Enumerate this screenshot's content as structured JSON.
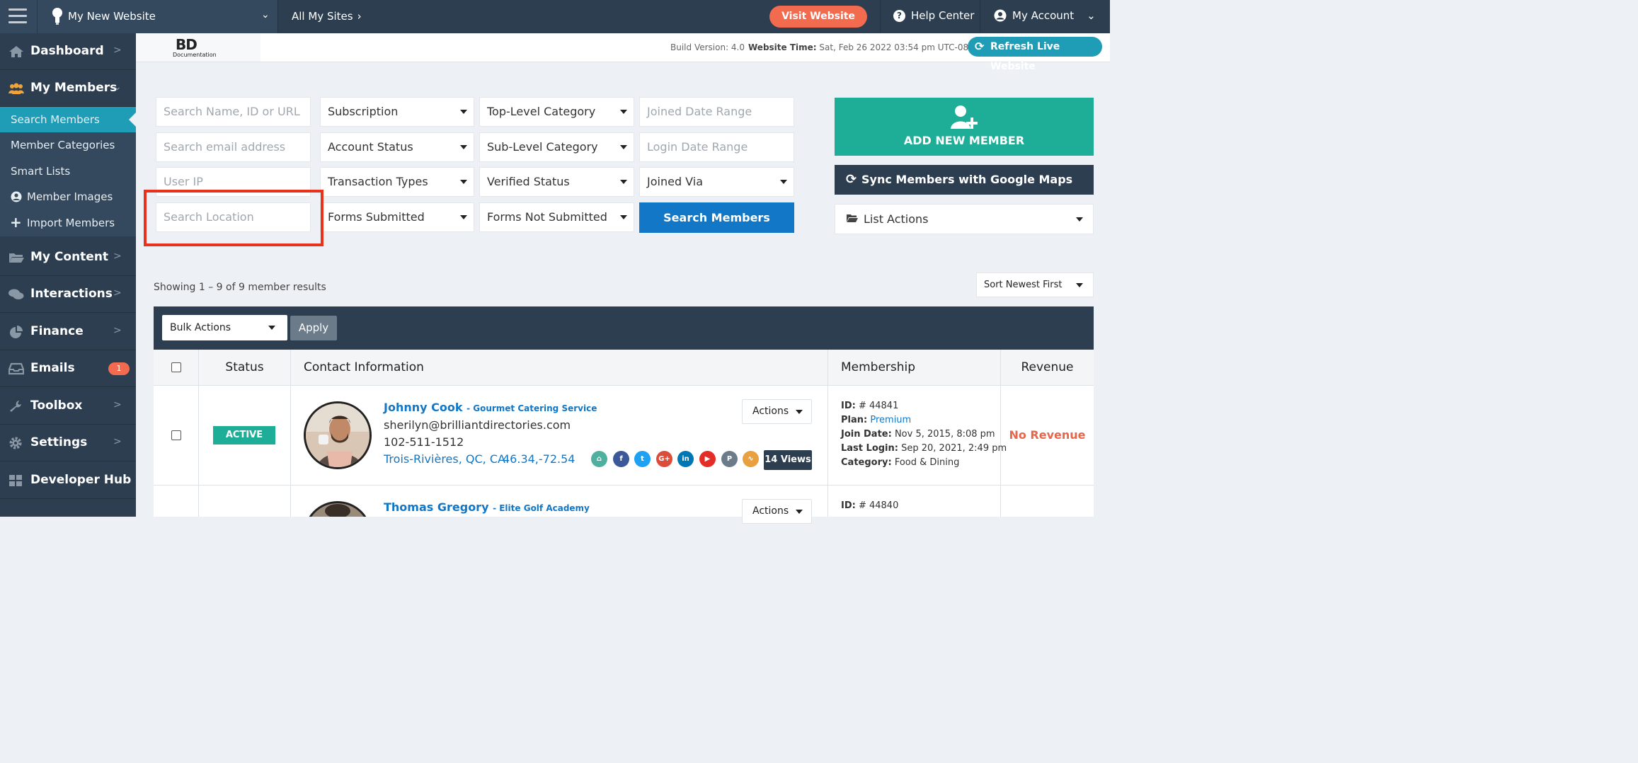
{
  "topbar": {
    "site_name": "My New Website",
    "all_sites": "All My Sites",
    "visit_website": "Visit Website",
    "help_center": "Help Center",
    "my_account": "My Account"
  },
  "subheader": {
    "logo_text": "BD",
    "logo_sub": "Documentation",
    "build_version": "Build Version: 4.0",
    "website_time_label": "Website Time:",
    "website_time_value": "Sat, Feb 26 2022 03:54 pm UTC-08:00",
    "refresh_live": "Refresh Live Website"
  },
  "sidebar": {
    "items": [
      {
        "label": "Dashboard",
        "icon": "home-icon"
      },
      {
        "label": "My Members",
        "icon": "users-icon"
      },
      {
        "label": "My Content",
        "icon": "folder-icon"
      },
      {
        "label": "Interactions",
        "icon": "comments-icon"
      },
      {
        "label": "Finance",
        "icon": "pie-chart-icon"
      },
      {
        "label": "Emails",
        "icon": "inbox-icon",
        "badge": "1"
      },
      {
        "label": "Toolbox",
        "icon": "wrench-icon"
      },
      {
        "label": "Settings",
        "icon": "gear-icon"
      },
      {
        "label": "Developer Hub",
        "icon": "grid-icon"
      }
    ],
    "sub_items": [
      {
        "label": "Search Members"
      },
      {
        "label": "Member Categories"
      },
      {
        "label": "Smart Lists"
      },
      {
        "label": "Member Images"
      },
      {
        "label": "Import Members"
      }
    ]
  },
  "filters": {
    "search_name_placeholder": "Search Name, ID or URL",
    "search_email_placeholder": "Search email address",
    "user_ip_placeholder": "User IP",
    "search_location_placeholder": "Search Location",
    "subscription": "Subscription",
    "account_status": "Account Status",
    "transaction_types": "Transaction Types",
    "forms_submitted": "Forms Submitted",
    "top_level_category": "Top-Level Category",
    "sub_level_category": "Sub-Level Category",
    "verified_status": "Verified Status",
    "forms_not_submitted": "Forms Not Submitted",
    "joined_date_range": "Joined Date Range",
    "login_date_range": "Login Date Range",
    "joined_via": "Joined Via",
    "search_members_button": "Search Members"
  },
  "side_actions": {
    "add_new_member": "ADD NEW MEMBER",
    "sync_google_maps": "Sync Members with Google Maps",
    "list_actions": "List Actions"
  },
  "results": {
    "showing": "Showing 1 – 9 of 9 member results",
    "sort": "Sort Newest First",
    "bulk_actions": "Bulk Actions",
    "apply": "Apply"
  },
  "table": {
    "headers": {
      "status": "Status",
      "contact": "Contact Information",
      "membership": "Membership",
      "revenue": "Revenue"
    },
    "rows": [
      {
        "status": "ACTIVE",
        "name": "Johnny Cook",
        "company": "- Gourmet Catering Service",
        "email": "sherilyn@brilliantdirectories.com",
        "phone": "102-511-1512",
        "location": "Trois-Rivières, QC, CA",
        "coords": "46.34,-72.54",
        "actions": "Actions",
        "views": "14 Views",
        "id_label": "ID:",
        "id_value": "# 44841",
        "plan_label": "Plan:",
        "plan_value": "Premium",
        "join_label": "Join Date:",
        "join_value": "Nov 5, 2015, 8:08 pm",
        "login_label": "Last Login:",
        "login_value": "Sep 20, 2021, 2:49 pm",
        "category_label": "Category:",
        "category_value": "Food & Dining",
        "revenue": "No Revenue"
      },
      {
        "name": "Thomas Gregory",
        "company": "- Elite Golf Academy",
        "actions": "Actions",
        "id_label": "ID:",
        "id_value": "# 44840"
      }
    ]
  },
  "social_icons": [
    {
      "name": "home-icon",
      "color": "#4fb0a0"
    },
    {
      "name": "facebook-icon",
      "color": "#3b5998"
    },
    {
      "name": "twitter-icon",
      "color": "#1da1f2"
    },
    {
      "name": "google-plus-icon",
      "color": "#dd4b39"
    },
    {
      "name": "linkedin-icon",
      "color": "#0077b5"
    },
    {
      "name": "youtube-icon",
      "color": "#e52d27"
    },
    {
      "name": "pinterest-icon",
      "color": "#6b7b8a"
    },
    {
      "name": "rss-icon",
      "color": "#e8a040"
    }
  ],
  "colors": {
    "sidebar_bg": "#2c3e50",
    "accent_teal": "#1eae98",
    "accent_blue": "#1177c6",
    "visit_orange": "#f26b4f",
    "highlight_red": "#e8321c"
  }
}
